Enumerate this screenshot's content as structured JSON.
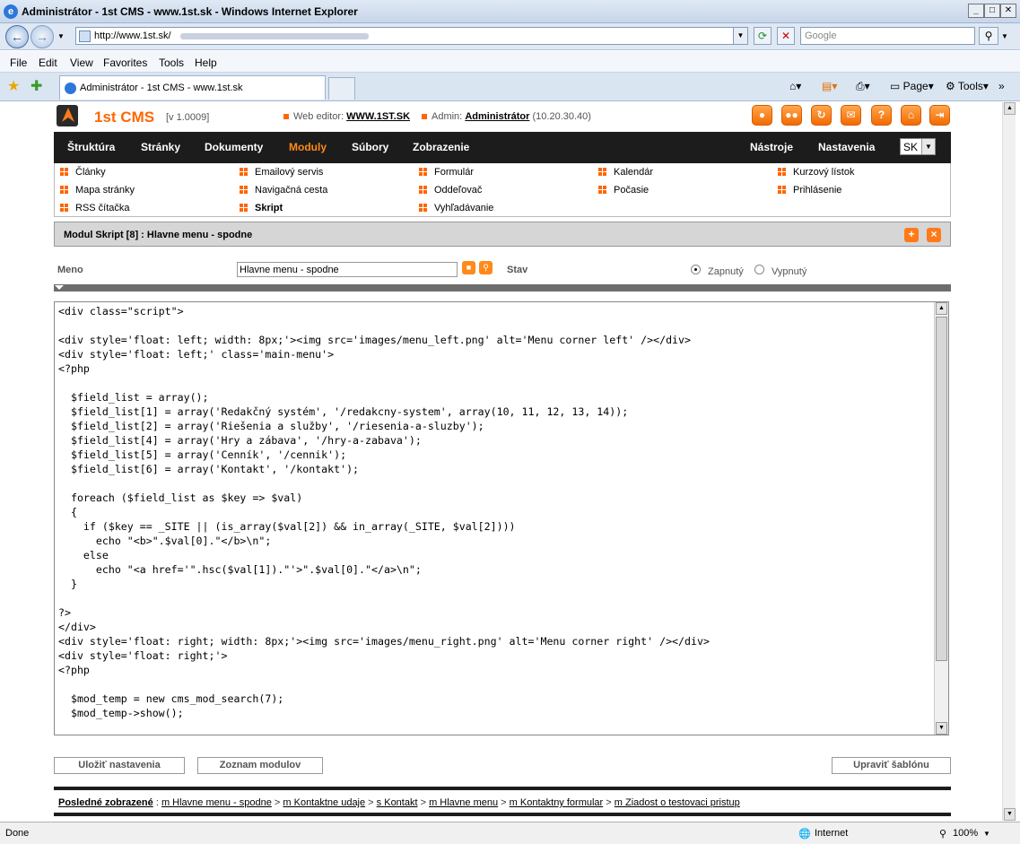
{
  "browser": {
    "window_title": "Administrátor - 1st CMS - www.1st.sk - Windows Internet Explorer",
    "address": "http://www.1st.sk/",
    "search_placeholder": "Google",
    "menu": [
      "File",
      "Edit",
      "View",
      "Favorites",
      "Tools",
      "Help"
    ],
    "tab_title": "Administrátor - 1st CMS - www.1st.sk",
    "commands": {
      "page": "Page",
      "tools": "Tools"
    },
    "status": {
      "left": "Done",
      "zone": "Internet",
      "zoom": "100%"
    }
  },
  "cms": {
    "brand": "1st CMS",
    "version": "[v 1.0009]",
    "web_editor_label": "Web editor:",
    "web_editor_value": "WWW.1ST.SK",
    "admin_label": "Admin:",
    "admin_value": "Administrátor",
    "admin_ip": "(10.20.30.40)",
    "nav": [
      "Štruktúra",
      "Stránky",
      "Dokumenty",
      "Moduly",
      "Súbory",
      "Zobrazenie"
    ],
    "nav_right": [
      "Nástroje",
      "Nastavenia"
    ],
    "lang": "SK",
    "subnav": [
      [
        "Články",
        "Emailový servis",
        "Formulár",
        "Kalendár",
        "Kurzový lístok"
      ],
      [
        "Mapa stránky",
        "Navigačná cesta",
        "Oddeľovač",
        "Počasie",
        "Prihlásenie"
      ],
      [
        "RSS čítačka",
        "Skript",
        "Vyhľadávanie"
      ]
    ],
    "module_header": "Modul Skript [8] : Hlavne menu - spodne",
    "form": {
      "name_label": "Meno",
      "name_value": "Hlavne menu - spodne",
      "state_label": "Stav",
      "state_on": "Zapnutý",
      "state_off": "Vypnutý"
    },
    "code": "<div class=\"script\">\n\n<div style='float: left; width: 8px;'><img src='images/menu_left.png' alt='Menu corner left' /></div>\n<div style='float: left;' class='main-menu'>\n<?php\n\n  $field_list = array();\n  $field_list[1] = array('Redakčný systém', '/redakcny-system', array(10, 11, 12, 13, 14));\n  $field_list[2] = array('Riešenia a služby', '/riesenia-a-sluzby');\n  $field_list[4] = array('Hry a zábava', '/hry-a-zabava');\n  $field_list[5] = array('Cenník', '/cennik');\n  $field_list[6] = array('Kontakt', '/kontakt');\n\n  foreach ($field_list as $key => $val)\n  {\n    if ($key == _SITE || (is_array($val[2]) && in_array(_SITE, $val[2])))\n      echo \"<b>\".$val[0].\"</b>\\n\";\n    else\n      echo \"<a href='\".hsc($val[1]).\"'>\".$val[0].\"</a>\\n\";\n  }\n\n?>\n</div>\n<div style='float: right; width: 8px;'><img src='images/menu_right.png' alt='Menu corner right' /></div>\n<div style='float: right;'>\n<?php\n\n  $mod_temp = new cms_mod_search(7);\n  $mod_temp->show();",
    "buttons": {
      "save": "Uložiť nastavenia",
      "list": "Zoznam modulov",
      "edit_template": "Upraviť šablónu"
    },
    "recent_label": "Posledné zobrazené",
    "recent": [
      "m Hlavne menu - spodne",
      "m Kontaktne udaje",
      "s Kontakt",
      "m Hlavne menu",
      "m Kontaktny formular",
      "m Ziadost o testovaci pristup"
    ]
  }
}
